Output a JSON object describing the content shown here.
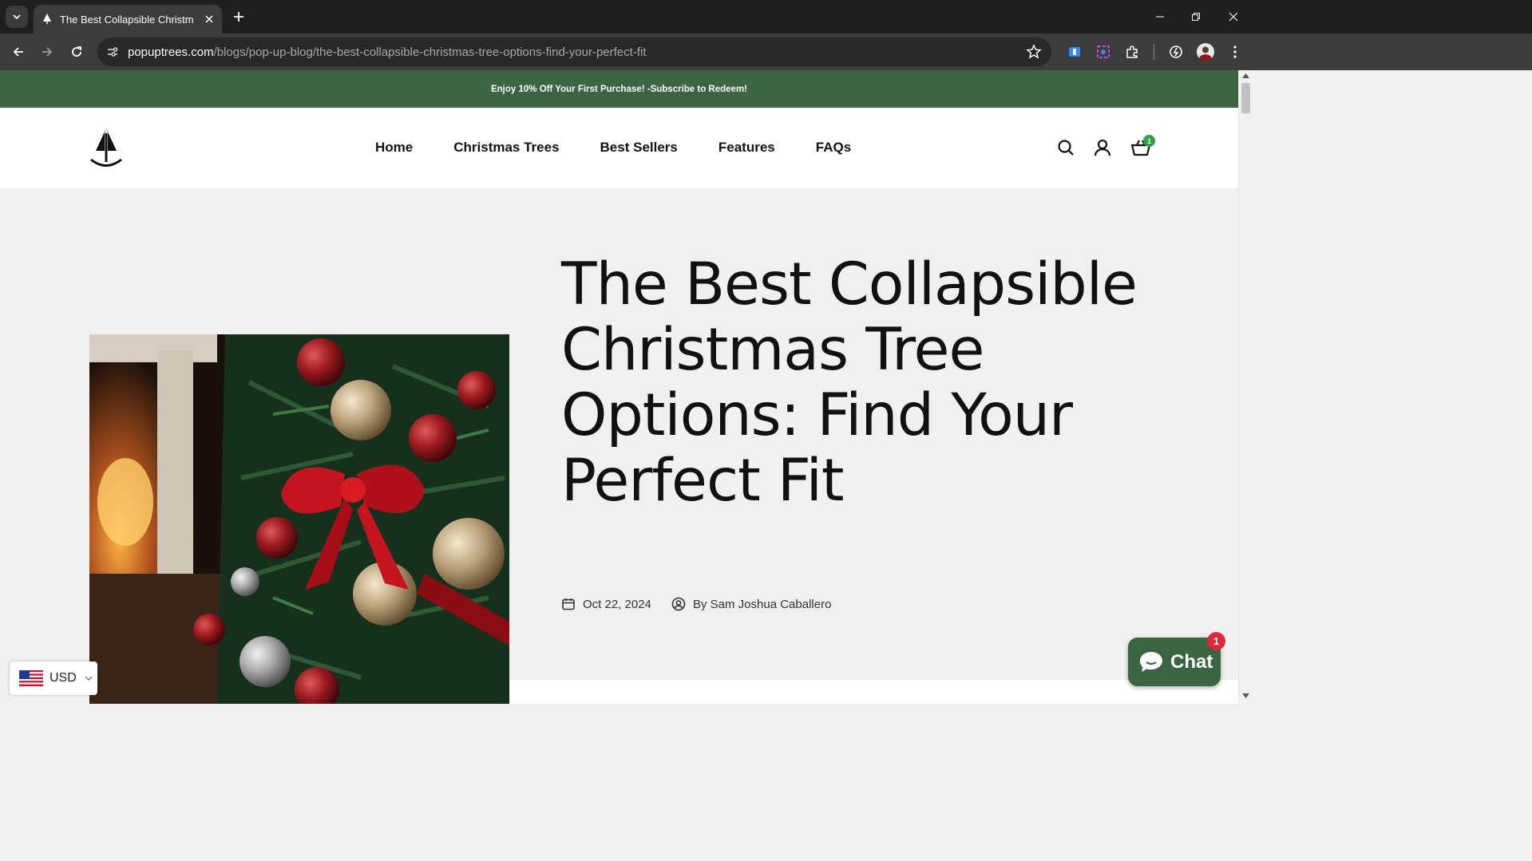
{
  "browser": {
    "tab": {
      "title": "The Best Collapsible Christmas Tree Options: Find Your Perfect Fit"
    },
    "url": {
      "domain": "popuptrees.com",
      "path": "/blogs/pop-up-blog/the-best-collapsible-christmas-tree-options-find-your-perfect-fit"
    }
  },
  "announcement": {
    "text": "Enjoy 10% Off Your First Purchase! -Subscribe to Redeem!"
  },
  "nav": {
    "items": [
      {
        "label": "Home"
      },
      {
        "label": "Christmas Trees"
      },
      {
        "label": "Best Sellers"
      },
      {
        "label": "Features"
      },
      {
        "label": "FAQs"
      }
    ],
    "cart_count": "1"
  },
  "article": {
    "title": "The Best Collapsible Christmas Tree Options: Find Your Perfect Fit",
    "date": "Oct 22, 2024",
    "author": "By Sam Joshua Caballero"
  },
  "currency": {
    "code": "USD"
  },
  "chat": {
    "label": "Chat",
    "badge": "1"
  },
  "colors": {
    "brand_green": "#3b6442",
    "badge_green": "#2fa043",
    "badge_red": "#e0263a"
  }
}
